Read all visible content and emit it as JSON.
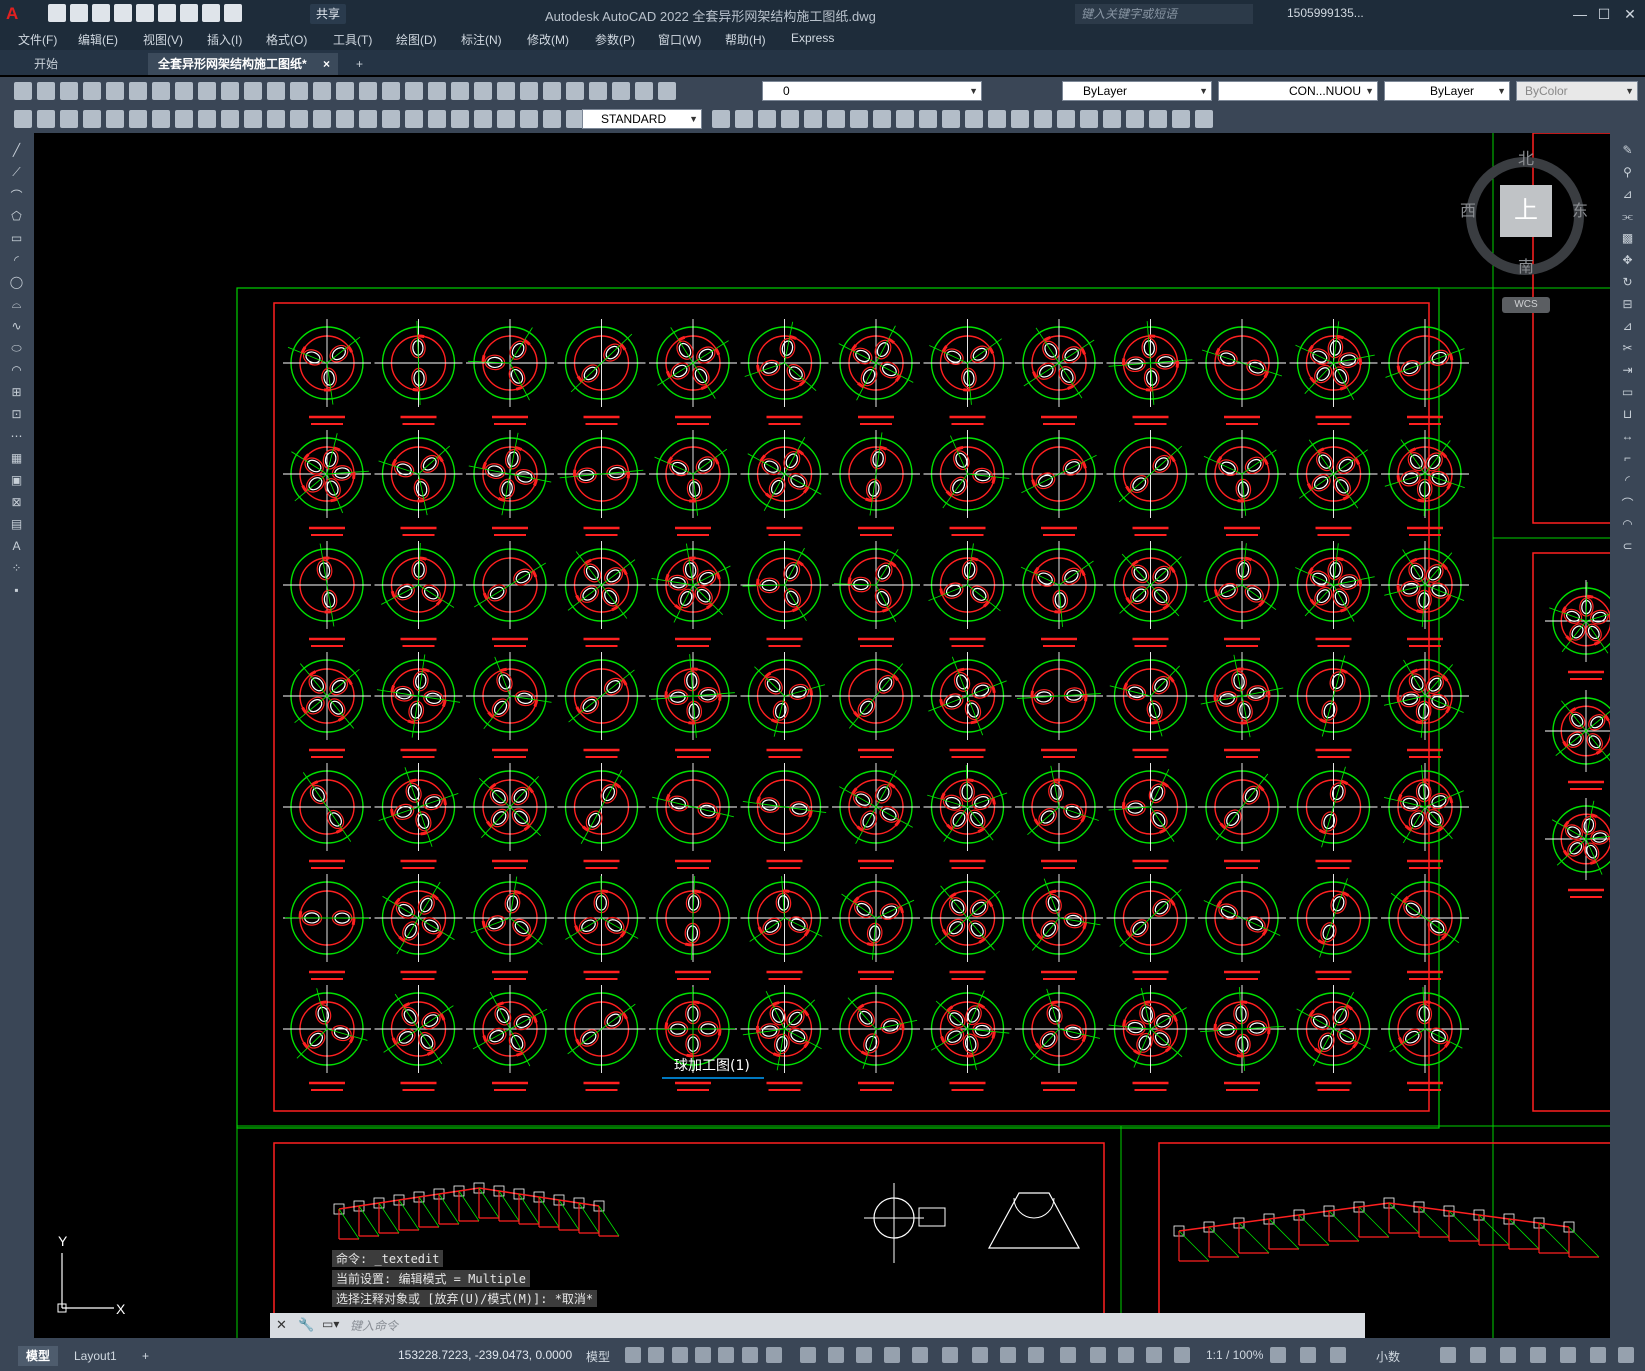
{
  "window": {
    "title": "Autodesk AutoCAD 2022    全套异形网架结构施工图纸.dwg",
    "share_label": "共享",
    "search_placeholder": "键入关键字或短语",
    "user": "1505999135...",
    "logo": "A"
  },
  "menu": [
    "文件(F)",
    "编辑(E)",
    "视图(V)",
    "插入(I)",
    "格式(O)",
    "工具(T)",
    "绘图(D)",
    "标注(N)",
    "修改(M)",
    "参数(P)",
    "窗口(W)",
    "帮助(H)",
    "Express"
  ],
  "tabs": {
    "start": "开始",
    "active": "全套异形网架结构施工图纸*",
    "close": "×",
    "add": "+"
  },
  "properties": {
    "layer": "0",
    "color": "ByLayer",
    "linetype": "CON...NUOU",
    "lineweight": "ByLayer",
    "plotstyle": "ByColor",
    "textstyle": "STANDARD"
  },
  "viewcube": {
    "north": "北",
    "south": "南",
    "west": "西",
    "east": "东",
    "top": "上",
    "wcs": "WCS"
  },
  "drawing": {
    "caption": "球加工图(1)",
    "colors": {
      "frame_green": "#00d000",
      "frame_red": "#ff2020",
      "ucs": "#ffffff"
    }
  },
  "command": {
    "history": [
      "命令: _textedit",
      "当前设置: 编辑模式 = Multiple",
      "选择注释对象或 [放弃(U)/模式(M)]: *取消*"
    ],
    "placeholder": "键入命令"
  },
  "ucs": {
    "y": "Y",
    "x": "X"
  },
  "status": {
    "model_tab": "模型",
    "layout_tab": "Layout1",
    "coordinates": "153228.7223, -239.0473, 0.0000",
    "model_label": "模型",
    "scale": "1:1 / 100%",
    "units": "小数"
  }
}
